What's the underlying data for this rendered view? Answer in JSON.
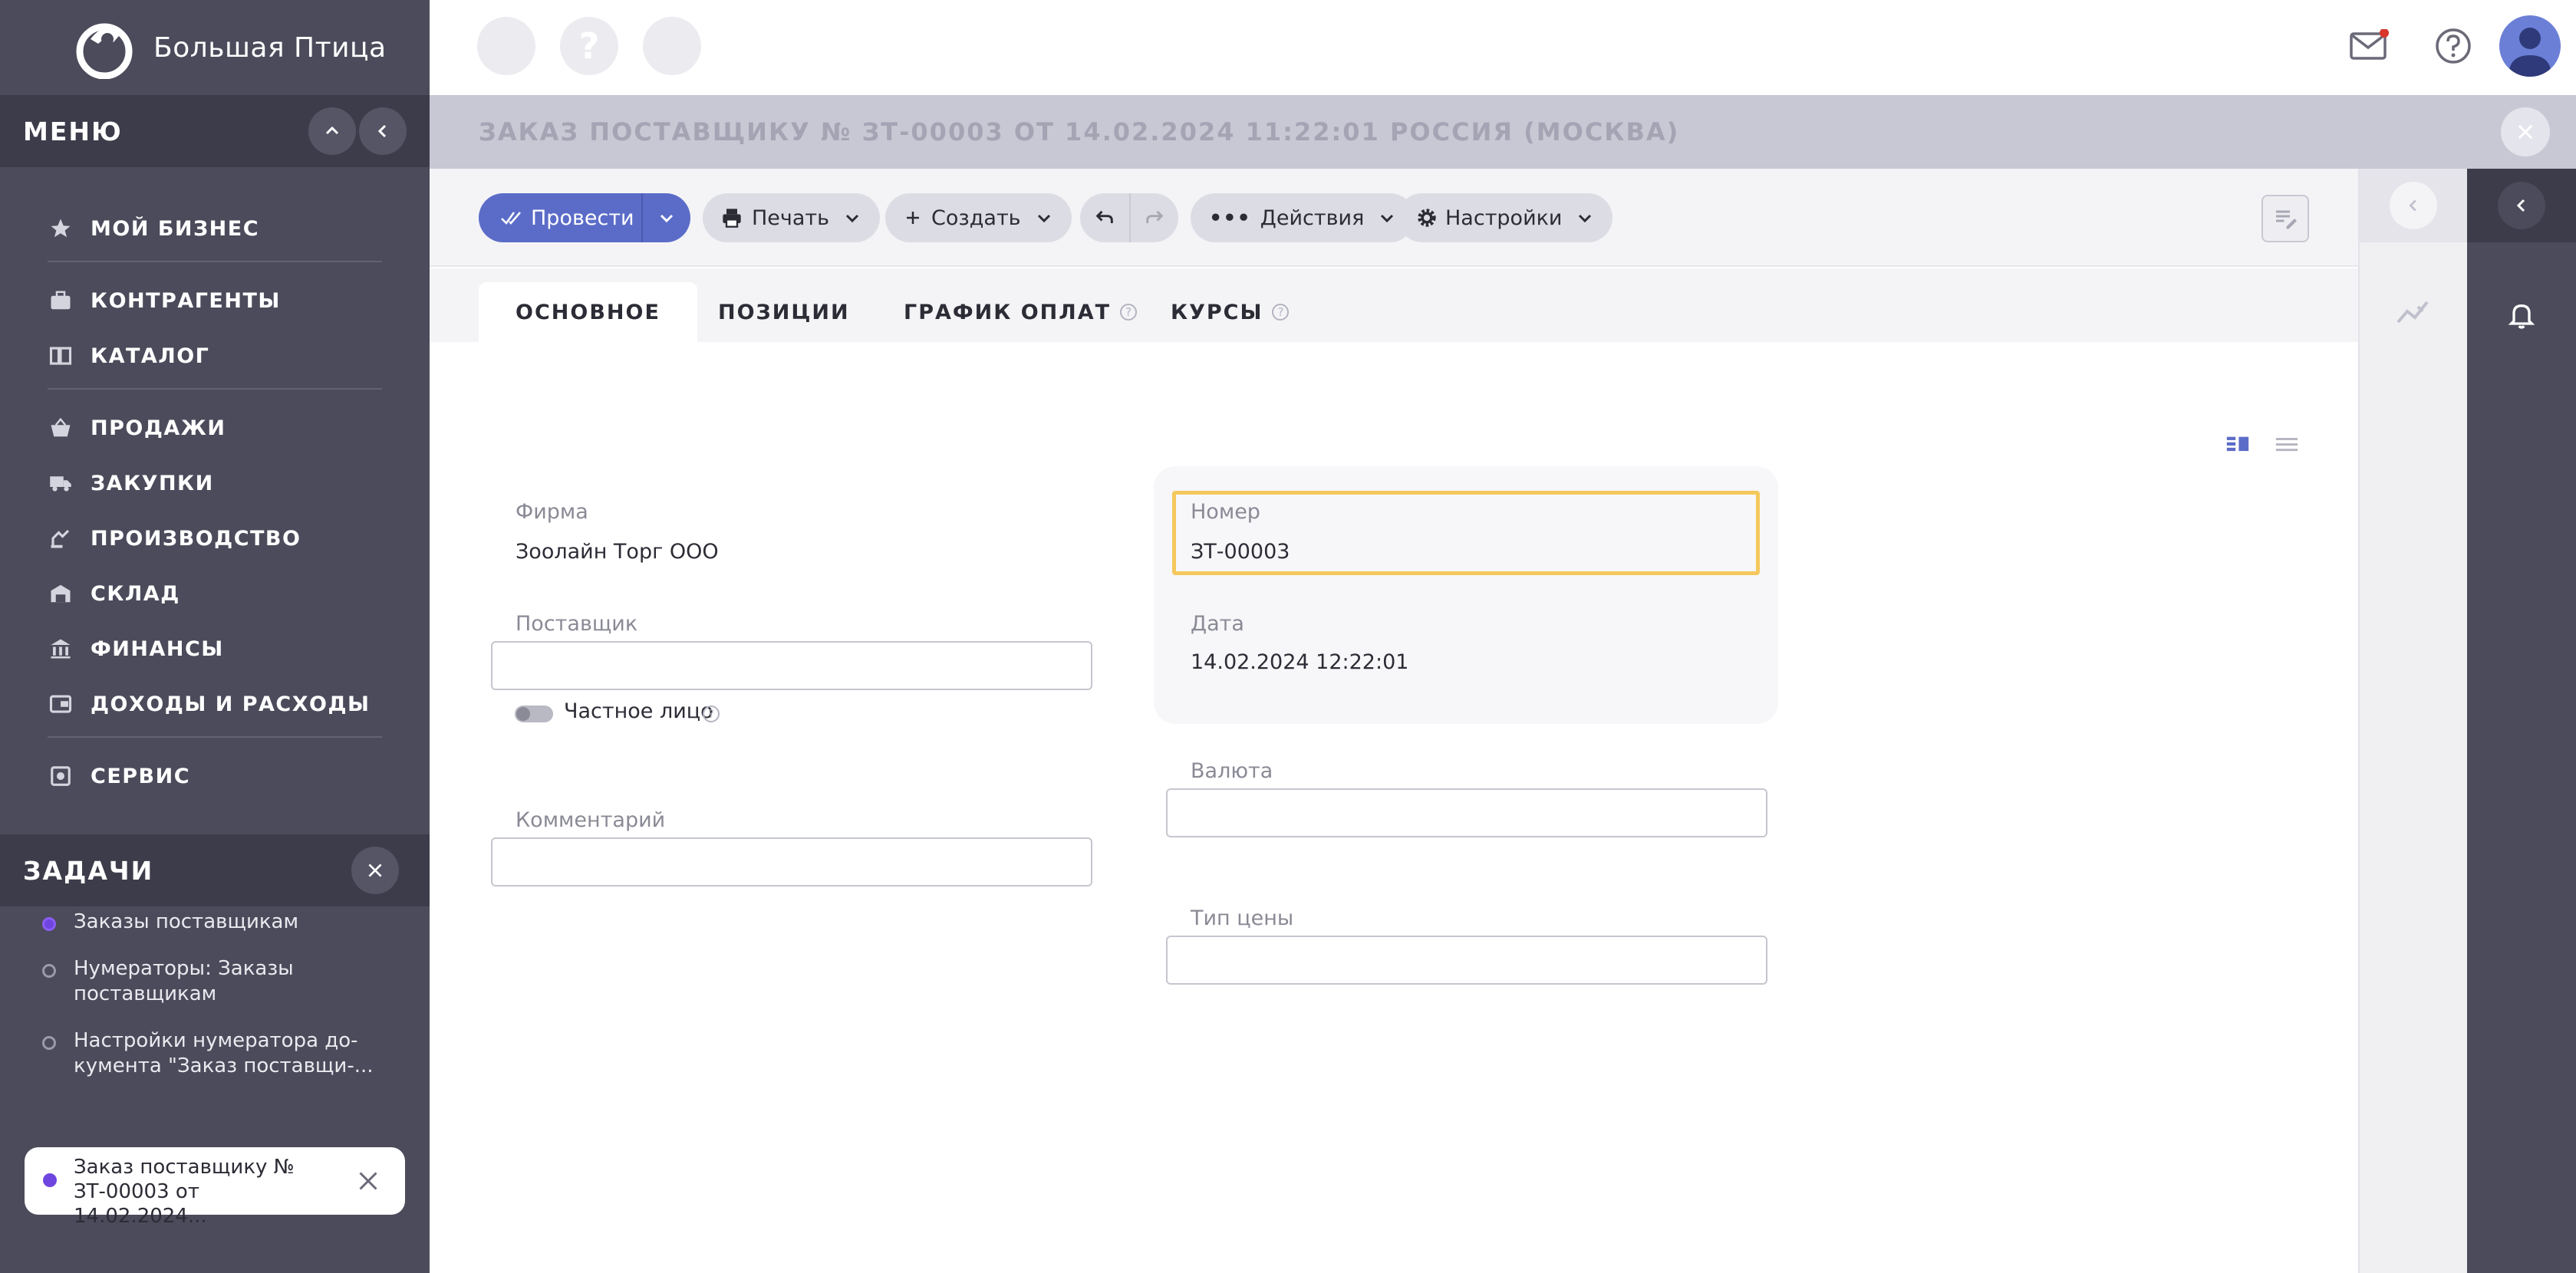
{
  "brand": {
    "name": "Большая Птица"
  },
  "sidebar": {
    "menu_title": "МЕНЮ",
    "items": [
      {
        "label": "МОЙ БИЗНЕС",
        "icon": "star-icon"
      },
      {
        "label": "КОНТРАГЕНТЫ",
        "icon": "briefcase-icon"
      },
      {
        "label": "КАТАЛОГ",
        "icon": "book-icon"
      },
      {
        "label": "ПРОДАЖИ",
        "icon": "basket-icon"
      },
      {
        "label": "ЗАКУПКИ",
        "icon": "truck-icon"
      },
      {
        "label": "ПРОИЗВОДСТВО",
        "icon": "factory-icon"
      },
      {
        "label": "СКЛАД",
        "icon": "warehouse-icon"
      },
      {
        "label": "ФИНАНСЫ",
        "icon": "bank-icon"
      },
      {
        "label": "ДОХОДЫ И РАСХОДЫ",
        "icon": "wallet-icon"
      },
      {
        "label": "СЕРВИС",
        "icon": "service-icon"
      }
    ],
    "tasks_title": "ЗАДАЧИ",
    "tasks": [
      {
        "label": "Заказы поставщикам"
      },
      {
        "label": "Нумераторы: Заказы поставщикам"
      },
      {
        "label": "Настройки нумератора до-кумента \"Заказ поставщи-..."
      }
    ],
    "active_task": {
      "label": "Заказ поставщику № ЗТ-00003 от 14.02.2024..."
    }
  },
  "topbar": {
    "help_glyph": "?"
  },
  "document": {
    "title": "ЗАКАЗ ПОСТАВЩИКУ № ЗТ-00003 ОТ 14.02.2024 11:22:01 РОССИЯ (МОСКВА)"
  },
  "toolbar": {
    "post_label": "Провести",
    "print_label": "Печать",
    "create_label": "Создать",
    "actions_label": "Действия",
    "settings_label": "Настройки"
  },
  "tabs": [
    {
      "label": "ОСНОВНОЕ",
      "active": true
    },
    {
      "label": "ПОЗИЦИИ",
      "active": false
    },
    {
      "label": "ГРАФИК ОПЛАТ",
      "active": false
    },
    {
      "label": "КУРСЫ",
      "active": false
    }
  ],
  "form": {
    "firm_label": "Фирма",
    "firm_value": "Зоолайн Торг ООО",
    "supplier_label": "Поставщик",
    "supplier_value": "",
    "private_person_label": "Частное лицо",
    "comment_label": "Комментарий",
    "comment_value": "",
    "number_label": "Номер",
    "number_value": "ЗТ-00003",
    "date_label": "Дата",
    "date_value": "14.02.2024 12:22:01",
    "currency_label": "Валюта",
    "currency_value": "",
    "price_type_label": "Тип цены",
    "price_type_value": ""
  },
  "colors": {
    "sidebar_bg": "#4b4b5b",
    "primary": "#5b6cc8",
    "focus": "#f4c85c",
    "notification": "#d8342c"
  }
}
